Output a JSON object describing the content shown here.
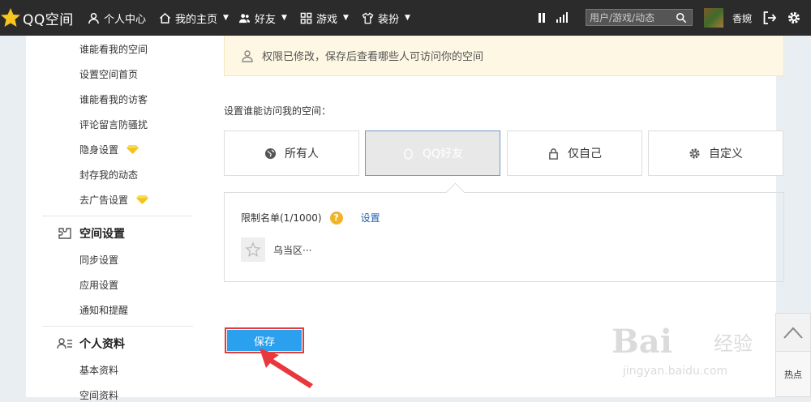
{
  "topbar": {
    "logo_text": "QQ空间",
    "nav": [
      {
        "label": "个人中心",
        "icon": "person-icon"
      },
      {
        "label": "我的主页",
        "icon": "home-icon"
      },
      {
        "label": "好友",
        "icon": "friends-icon"
      },
      {
        "label": "游戏",
        "icon": "grid-icon"
      },
      {
        "label": "装扮",
        "icon": "shirt-icon"
      }
    ],
    "search_placeholder": "用户/游戏/动态",
    "username": "香婉"
  },
  "sidebar": {
    "privacy_items": [
      {
        "label": "谁能看我的空间"
      },
      {
        "label": "设置空间首页"
      },
      {
        "label": "谁能看我的访客"
      },
      {
        "label": "评论留言防骚扰"
      },
      {
        "label": "隐身设置"
      },
      {
        "label": "封存我的动态"
      },
      {
        "label": "去广告设置"
      }
    ],
    "section_space": "空间设置",
    "space_items": [
      {
        "label": "同步设置"
      },
      {
        "label": "应用设置"
      },
      {
        "label": "通知和提醒"
      }
    ],
    "section_profile": "个人资料",
    "profile_items": [
      {
        "label": "基本资料"
      },
      {
        "label": "空间资料"
      }
    ]
  },
  "main": {
    "notice": "权限已修改，保存后查看哪些人可访问你的空间",
    "section_label": "设置谁能访问我的空间：",
    "options": [
      {
        "label": "所有人",
        "icon": "globe-icon",
        "selected": false
      },
      {
        "label": "QQ好友",
        "icon": "qq-penguin-icon",
        "selected": true
      },
      {
        "label": "仅自己",
        "icon": "lock-icon",
        "selected": false
      },
      {
        "label": "自定义",
        "icon": "gear-icon",
        "selected": false
      }
    ],
    "limit_label": "限制名单(1/1000)",
    "help_glyph": "?",
    "set_link": "设置",
    "member_name": "乌当区···",
    "save_label": "保存"
  },
  "float": {
    "hot_label": "热点"
  },
  "watermark": {
    "brand": "Bai",
    "brand_cn": "经验",
    "url": "jingyan.baidu.com"
  },
  "colors": {
    "topbar": "#2b2b2b",
    "notice_bg": "#fdf7e3",
    "save_button": "#2aa0ef",
    "highlight_border": "#e03c3c",
    "link": "#1e62b0"
  }
}
